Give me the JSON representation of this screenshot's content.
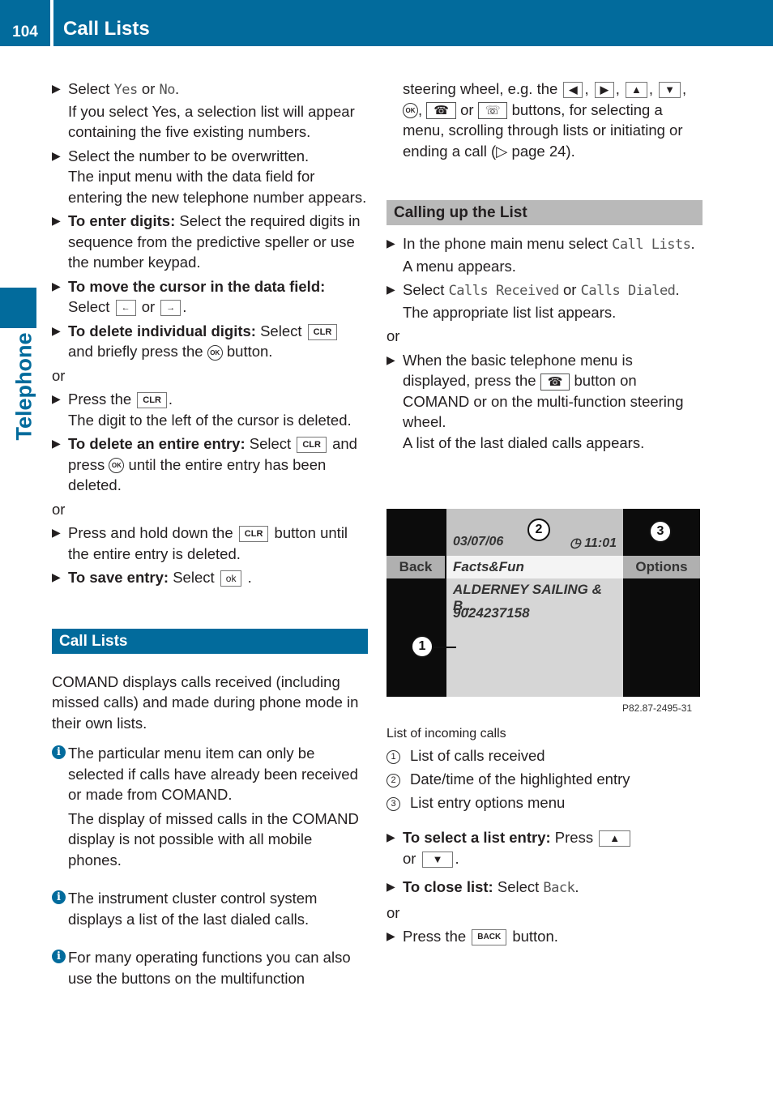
{
  "header": {
    "page_number": "104",
    "title": "Call Lists"
  },
  "side_tab": {
    "label": "Telephone"
  },
  "left_column": {
    "steps1": [
      {
        "pre": "Select ",
        "m1": "Yes",
        "mid": " or ",
        "m2": "No",
        "post": ".",
        "sub": [
          "If you select Yes, a selection list will appear containing the five existing numbers."
        ]
      },
      {
        "text": "Select the number to be overwritten.",
        "sub": [
          "The input menu with the data field for entering the new telephone number appears."
        ]
      }
    ],
    "enter_digits": {
      "bold": "To enter digits:",
      "text": " Select the required digits in sequence from the predictive speller or use the number keypad."
    },
    "move_cursor": {
      "bold": "To move the cursor in the data field:",
      "text1": "Select ",
      "key1": "←",
      "text2": " or ",
      "key2": "→",
      "text3": "."
    },
    "delete_digits": {
      "bold": "To delete individual digits:",
      "text1": " Select ",
      "key": "CLR",
      "text2": " and briefly press the ",
      "ok": "OK",
      "text3": " button."
    },
    "or1": "or",
    "press_clr": {
      "text1": "Press the ",
      "key": "CLR",
      "text2": ".",
      "sub": "The digit to the left of the cursor is deleted."
    },
    "delete_entry": {
      "bold": "To delete an entire entry:",
      "text1": " Select ",
      "key": "CLR",
      "text2": " and press ",
      "ok": "OK",
      "text3": " until the entire entry has been deleted."
    },
    "or2": "or",
    "hold_clr": {
      "text1": "Press and hold down the ",
      "key": "CLR",
      "text2": " button until the entire entry is deleted."
    },
    "save_entry": {
      "bold": "To save entry:",
      "text1": " Select ",
      "key": "ok",
      "text2": " ."
    },
    "section_title": "Call Lists",
    "intro": "COMAND displays calls received (including missed calls) and made during phone mode in their own lists.",
    "info1": {
      "p1": "The particular menu item can only be selected if calls have already been received or made from COMAND.",
      "p2": "The display of missed calls in the COMAND display is not possible with all mobile phones."
    },
    "info2": "The instrument cluster control system displays a list of the last dialed calls.",
    "info3": "For many operating functions you can also use the buttons on the multifunction"
  },
  "right_column": {
    "continued": {
      "t1": "steering wheel, e.g. the ",
      "k_left": "◀",
      "k_right": "▶",
      "k_up": "▲",
      "k_down": "▼",
      "ok": "OK",
      "or": " or ",
      "t2": " buttons, for selecting a menu, scrolling through lists or initiating or ending a call (▷ page 24)."
    },
    "section_title": "Calling up the List",
    "step1": {
      "text": "In the phone main menu select ",
      "mono": "Call Lists",
      "post": ".",
      "sub": "A menu appears."
    },
    "step2": {
      "text": "Select ",
      "mono1": "Calls Received",
      "mid": " or ",
      "mono2": "Calls Dialed",
      "post": ".",
      "sub": "The appropriate list list appears."
    },
    "or": "or",
    "step3": {
      "t1": "When the basic telephone menu is displayed, press the ",
      "t2": " button on COMAND or on the multi-function steering wheel.",
      "sub": "A list of the last dialed calls appears."
    },
    "screen": {
      "date": "03/07/06",
      "time": "11:01",
      "back": "Back",
      "options": "Options",
      "rows": [
        "Facts&Fun",
        "ALDERNEY SAILING & B...",
        "9024237158"
      ],
      "callouts": [
        "1",
        "2",
        "3"
      ],
      "part_no": "P82.87-2495-31"
    },
    "caption": "List of incoming calls",
    "legend": [
      {
        "num": "1",
        "text": "List of calls received"
      },
      {
        "num": "2",
        "text": "Date/time of the highlighted entry"
      },
      {
        "num": "3",
        "text": "List entry options menu"
      }
    ],
    "select_entry": {
      "bold": "To select a list entry:",
      "text1": " Press ",
      "k1": "▲",
      "text2": " or ",
      "k2": "▼",
      "text3": "."
    },
    "close_list": {
      "bold": "To close list:",
      "text1": " Select ",
      "mono": "Back",
      "text2": "."
    },
    "or2": "or",
    "press_back": {
      "text1": "Press the ",
      "key": "BACK",
      "text2": " button."
    }
  }
}
